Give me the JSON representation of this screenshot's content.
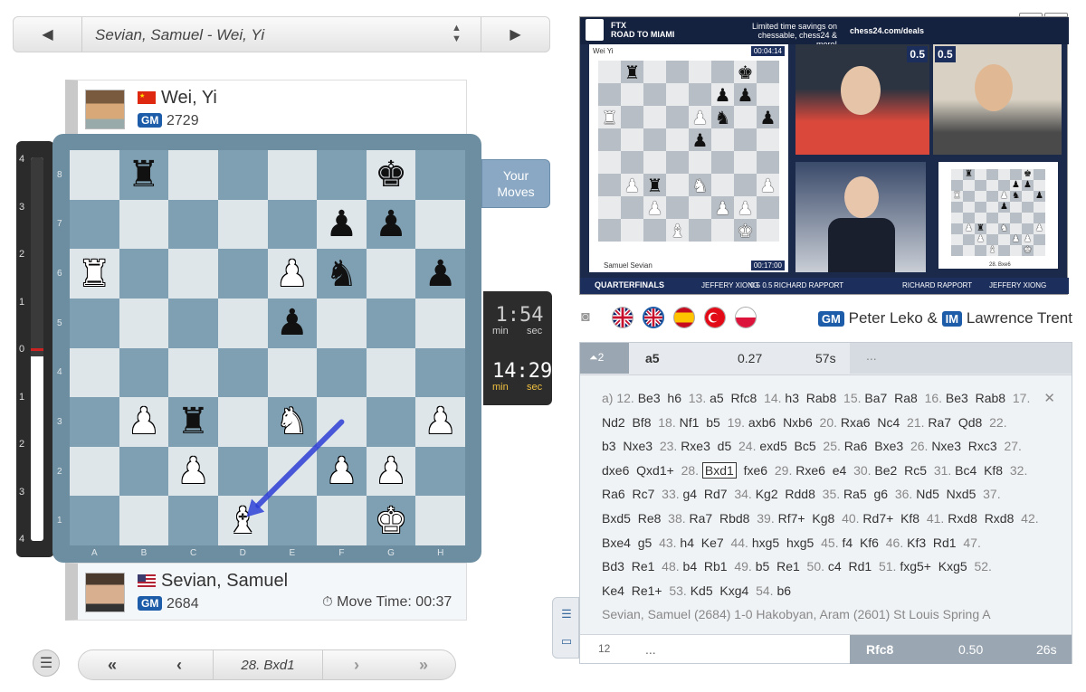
{
  "game_selector": {
    "title": "Sevian, Samuel - Wei, Yi",
    "prev_icon": "triangle-left-icon",
    "next_icon": "triangle-right-icon",
    "sort_icon": "sort-updown-icon"
  },
  "players": {
    "top": {
      "name": "Wei, Yi",
      "title": "GM",
      "rating": "2729",
      "flag": "cn"
    },
    "bottom": {
      "name": "Sevian, Samuel",
      "title": "GM",
      "rating": "2684",
      "flag": "us",
      "move_time_label": "Move Time: 00:37"
    }
  },
  "eval_bar": {
    "ticks": [
      "4",
      "3",
      "2",
      "1",
      "0",
      "1",
      "2",
      "3",
      "4"
    ],
    "white_share": 0.48
  },
  "board": {
    "files": [
      "A",
      "B",
      "C",
      "D",
      "E",
      "F",
      "G",
      "H"
    ],
    "ranks": [
      "8",
      "7",
      "6",
      "5",
      "4",
      "3",
      "2",
      "1"
    ],
    "pieces": {
      "b8": "bR",
      "g8": "bK",
      "f7": "bP",
      "g7": "bP",
      "a6": "wR",
      "e6": "wP",
      "f6": "bN",
      "h6": "bP",
      "e5": "bP",
      "b3": "wP",
      "c3": "bR",
      "e3": "wN",
      "h3": "wP",
      "c2": "wP",
      "f2": "wP",
      "g2": "wP",
      "d1": "wB",
      "g1": "wK"
    },
    "arrow": {
      "from": "f3",
      "to": "d1",
      "color": "#2e3fd6"
    }
  },
  "your_moves": {
    "line1": "Your",
    "line2": "Moves"
  },
  "clock": {
    "top_time": "1:54",
    "top_min": "min",
    "top_sec": "sec",
    "bot_time": "14:29",
    "bot_min": "min",
    "bot_sec": "sec"
  },
  "nav": {
    "menu_icon": "hamburger-icon",
    "first_icon": "double-chevron-left-icon",
    "prev_icon": "chevron-left-icon",
    "current_move": "28. Bxd1",
    "next_icon": "chevron-right-icon",
    "last_icon": "double-chevron-right-icon"
  },
  "video": {
    "event_line1": "FTX",
    "event_line2": "ROAD TO MIAMI",
    "promo_line1": "Limited time savings on",
    "promo_line2": "chessable, chess24 & more!",
    "promo_url": "chess24.com/deals",
    "board_top_player": "Wei Yi",
    "board_top_clock": "00:04:14",
    "board_bottom_player": "Samuel Sevian",
    "board_bottom_clock": "00:17:00",
    "score_left": "0.5",
    "score_right": "0.5",
    "stage": "QUARTERFINALS",
    "footer_match1": "JEFFERY XIONG",
    "footer_score1": "0.5 0.5",
    "footer_match2": "RICHARD RAPPORT",
    "footer_match3": "RICHARD RAPPORT",
    "footer_match4": "JEFFERY XIONG",
    "mini_move": "28. Bxe6"
  },
  "commentary": {
    "camera_icon": "camera-off-icon",
    "flags": [
      "gb",
      "gb",
      "es",
      "tr",
      "pl"
    ],
    "name1_title": "GM",
    "name1": "Peter Leko &",
    "name2_title": "IM",
    "name2": "Lawrence Trent"
  },
  "analysis": {
    "depth_label": "2",
    "header": {
      "move": "a5",
      "eval": "0.27",
      "time": "57s",
      "ellipsis": "..."
    },
    "line_prefix": "a)",
    "moves": [
      [
        "12.",
        "Be3",
        "h6"
      ],
      [
        "13.",
        "a5",
        "Rfc8"
      ],
      [
        "14.",
        "h3",
        "Rab8"
      ],
      [
        "15.",
        "Ba7",
        "Ra8"
      ],
      [
        "16.",
        "Be3",
        "Rab8"
      ],
      [
        "17.",
        "Nd2",
        "Bf8"
      ],
      [
        "18.",
        "Nf1",
        "b5"
      ],
      [
        "19.",
        "axb6",
        "Nxb6"
      ],
      [
        "20.",
        "Rxa6",
        "Nc4"
      ],
      [
        "21.",
        "Ra7",
        "Qd8"
      ],
      [
        "22.",
        "b3",
        "Nxe3"
      ],
      [
        "23.",
        "Rxe3",
        "d5"
      ],
      [
        "24.",
        "exd5",
        "Bc5"
      ],
      [
        "25.",
        "Ra6",
        "Bxe3"
      ],
      [
        "26.",
        "Nxe3",
        "Rxc3"
      ],
      [
        "27.",
        "dxe6",
        "Qxd1+"
      ],
      [
        "28.",
        "Bxd1",
        "fxe6"
      ],
      [
        "29.",
        "Rxe6",
        "e4"
      ],
      [
        "30.",
        "Be2",
        "Rc5"
      ],
      [
        "31.",
        "Bc4",
        "Kf8"
      ],
      [
        "32.",
        "Ra6",
        "Rc7"
      ],
      [
        "33.",
        "g4",
        "Rd7"
      ],
      [
        "34.",
        "Kg2",
        "Rdd8"
      ],
      [
        "35.",
        "Ra5",
        "g6"
      ],
      [
        "36.",
        "Nd5",
        "Nxd5"
      ],
      [
        "37.",
        "Bxd5",
        "Re8"
      ],
      [
        "38.",
        "Ra7",
        "Rbd8"
      ],
      [
        "39.",
        "Rf7+",
        "Kg8"
      ],
      [
        "40.",
        "Rd7+",
        "Kf8"
      ],
      [
        "41.",
        "Rxd8",
        "Rxd8"
      ],
      [
        "42.",
        "Bxe4",
        "g5"
      ],
      [
        "43.",
        "h4",
        "Ke7"
      ],
      [
        "44.",
        "hxg5",
        "hxg5"
      ],
      [
        "45.",
        "f4",
        "Kf6"
      ],
      [
        "46.",
        "Kf3",
        "Rd1"
      ],
      [
        "47.",
        "Bd3",
        "Re1"
      ],
      [
        "48.",
        "b4",
        "Rb1"
      ],
      [
        "49.",
        "b5",
        "Re1"
      ],
      [
        "50.",
        "c4",
        "Rd1"
      ],
      [
        "51.",
        "fxg5+",
        "Kxg5"
      ],
      [
        "52.",
        "Ke4",
        "Re1+"
      ],
      [
        "53.",
        "Kd5",
        "Kxg4"
      ],
      [
        "54.",
        "b6",
        ""
      ]
    ],
    "current_move": "Bxd1",
    "reference_game": "Sevian, Samuel (2684) 1-0 Hakobyan, Aram (2601) St Louis Spring A",
    "close_icon": "close-x-icon",
    "footer": {
      "depth": "12",
      "ellipsis": "...",
      "move": "Rfc8",
      "eval": "0.50",
      "time": "26s"
    },
    "side_tabs": [
      "list-icon",
      "chat-icon"
    ]
  }
}
